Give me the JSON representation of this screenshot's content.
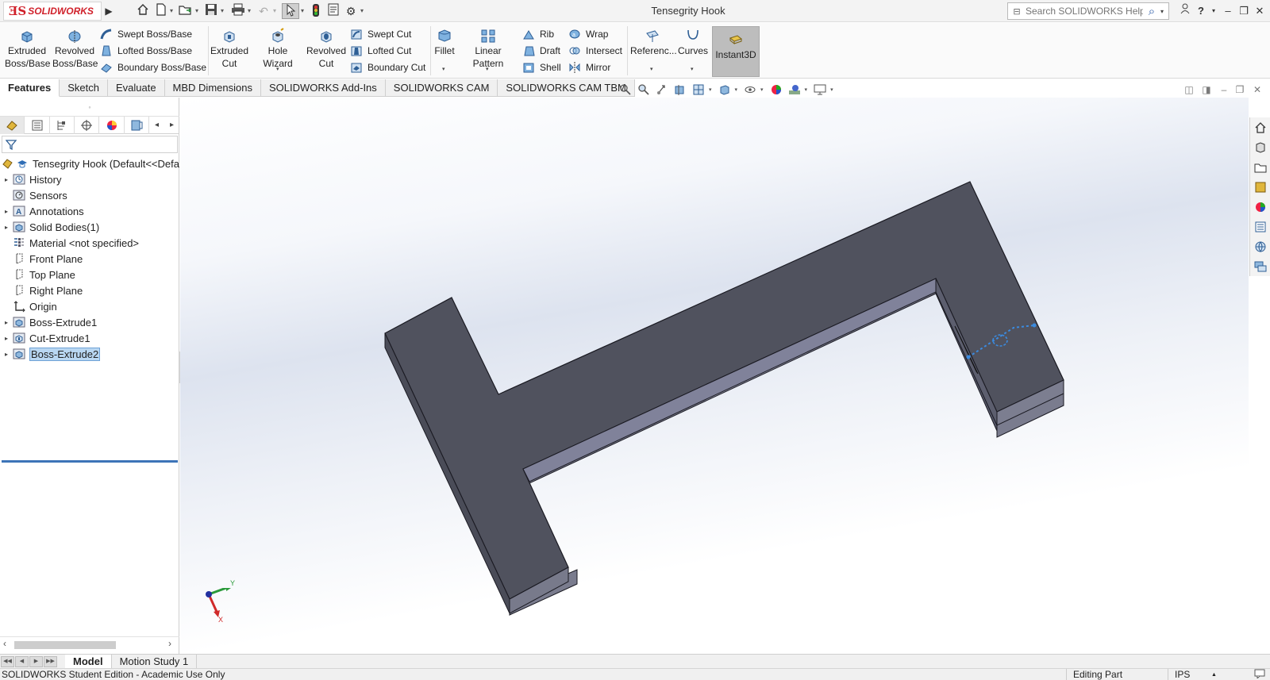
{
  "app": {
    "logo_ds": "ƎS",
    "logo_name": "SOLIDWORKS",
    "window_title": "Tensegrity Hook"
  },
  "help_search": {
    "placeholder": "Search SOLIDWORKS Help"
  },
  "ribbon": {
    "extruded_boss": "Extruded Boss/Base",
    "revolved_boss": "Revolved Boss/Base",
    "swept_boss": "Swept Boss/Base",
    "lofted_boss": "Lofted Boss/Base",
    "boundary_boss": "Boundary Boss/Base",
    "extruded_cut": "Extruded Cut",
    "hole_wizard": "Hole Wizard",
    "revolved_cut": "Revolved Cut",
    "swept_cut": "Swept Cut",
    "lofted_cut": "Lofted Cut",
    "boundary_cut": "Boundary Cut",
    "fillet": "Fillet",
    "linear_pattern": "Linear Pattern",
    "rib": "Rib",
    "draft": "Draft",
    "shell": "Shell",
    "wrap": "Wrap",
    "intersect": "Intersect",
    "mirror": "Mirror",
    "reference": "Referenc...",
    "curves": "Curves",
    "instant3d": "Instant3D"
  },
  "command_tabs": [
    "Features",
    "Sketch",
    "Evaluate",
    "MBD Dimensions",
    "SOLIDWORKS Add-Ins",
    "SOLIDWORKS CAM",
    "SOLIDWORKS CAM TBM"
  ],
  "feature_tree": {
    "root": "Tensegrity Hook  (Default<<Default>",
    "items": [
      {
        "label": "History",
        "icon": "history-icon",
        "expandable": true
      },
      {
        "label": "Sensors",
        "icon": "sensors-icon",
        "expandable": false
      },
      {
        "label": "Annotations",
        "icon": "annotations-icon",
        "expandable": true
      },
      {
        "label": "Solid Bodies(1)",
        "icon": "solid-bodies-icon",
        "expandable": true
      },
      {
        "label": "Material <not specified>",
        "icon": "material-icon",
        "expandable": false
      },
      {
        "label": "Front Plane",
        "icon": "plane-icon",
        "expandable": false
      },
      {
        "label": "Top Plane",
        "icon": "plane-icon",
        "expandable": false
      },
      {
        "label": "Right Plane",
        "icon": "plane-icon",
        "expandable": false
      },
      {
        "label": "Origin",
        "icon": "origin-icon",
        "expandable": false
      },
      {
        "label": "Boss-Extrude1",
        "icon": "boss-extrude-icon",
        "expandable": true
      },
      {
        "label": "Cut-Extrude1",
        "icon": "cut-extrude-icon",
        "expandable": true
      },
      {
        "label": "Boss-Extrude2",
        "icon": "boss-extrude-icon",
        "expandable": true,
        "selected": true
      }
    ]
  },
  "triad": {
    "x_label": "X",
    "y_label": "Y"
  },
  "bottom_tabs": [
    "Model",
    "Motion Study 1"
  ],
  "status": {
    "left": "SOLIDWORKS Student Edition - Academic Use Only",
    "mode": "Editing Part",
    "units": "IPS"
  },
  "colors": {
    "brand_red": "#d0202a",
    "model_top": "#4f515d",
    "model_side": "#6a6c7c",
    "selection_blue": "#3b8be0"
  }
}
